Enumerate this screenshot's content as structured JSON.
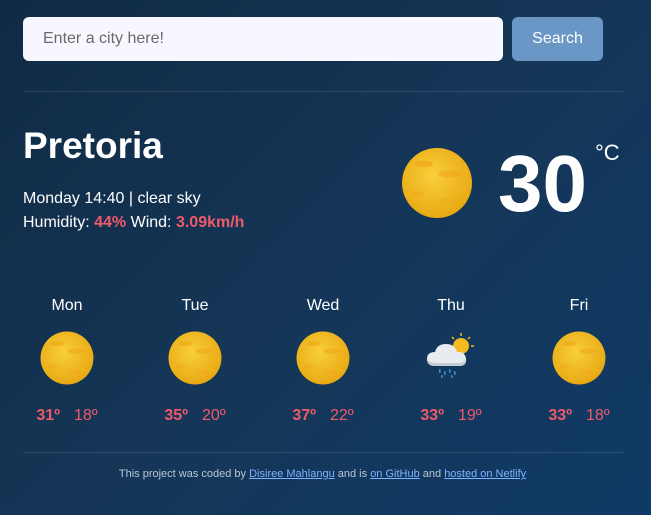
{
  "search": {
    "placeholder": "Enter a city here!",
    "value": "",
    "button_label": "Search"
  },
  "current": {
    "city": "Pretoria",
    "day_time": "Monday 14:40",
    "separator": " | ",
    "description": "clear sky",
    "humidity_label": "Humidity: ",
    "humidity_value": "44%",
    "wind_label": " Wind: ",
    "wind_value": "3.09km/h",
    "temperature": "30",
    "unit": "°C",
    "icon": "sun-icon"
  },
  "forecast": [
    {
      "day": "Mon",
      "max": "31º",
      "min": "18º",
      "icon": "sun-icon"
    },
    {
      "day": "Tue",
      "max": "35º",
      "min": "20º",
      "icon": "sun-icon"
    },
    {
      "day": "Wed",
      "max": "37º",
      "min": "22º",
      "icon": "sun-icon"
    },
    {
      "day": "Thu",
      "max": "33º",
      "min": "19º",
      "icon": "cloud-rain-sun-icon"
    },
    {
      "day": "Fri",
      "max": "33º",
      "min": "18º",
      "icon": "sun-icon"
    }
  ],
  "footer": {
    "text1": "This project was coded by ",
    "author_link": "Disiree Mahlangu",
    "text2": " and is ",
    "github_link": "on GitHub",
    "text3": " and ",
    "netlify_link": "hosted on Netlify"
  },
  "colors": {
    "background": "#153657",
    "accent": "#ef5a6a",
    "button": "#6a97c5",
    "sun": "#f5bb1f"
  }
}
